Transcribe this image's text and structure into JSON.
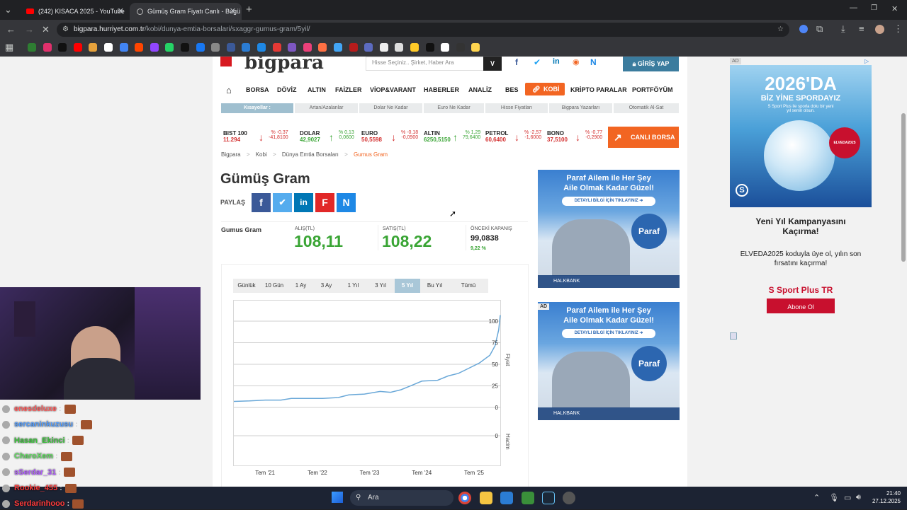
{
  "browser": {
    "tabs": [
      {
        "title": "(242) KISACA 2025 - YouTube",
        "active": false
      },
      {
        "title": "Gümüş Gram Fiyatı Canlı - Bugü",
        "active": true
      }
    ],
    "new_tab": "+",
    "url_host": "bigpara.hurriyet.com.tr",
    "url_path": "/kobi/dunya-emtia-borsalari/sxaggr-gumus-gram/5yil/",
    "window_controls": {
      "minimize": "—",
      "maximize": "❐",
      "close": "✕"
    }
  },
  "site": {
    "logo": "bigpara",
    "search_placeholder": "Hisse Seçiniz.. Şirket, Haber Ara",
    "login_label": "GİRİŞ YAP",
    "nav": [
      "BORSA",
      "DÖVİZ",
      "ALTIN",
      "FAİZLER",
      "VİOP&VARANT",
      "HABERLER",
      "ANALİZ",
      "BES",
      "KOBİ",
      "KRİPTO PARALAR",
      "PORTFÖYÜM"
    ],
    "quicklinks": [
      "Kısayollar :",
      "Artan/Azalanlar",
      "Dolar Ne Kadar",
      "Euro Ne Kadar",
      "Hisse Fiyatları",
      "Bigpara Yazarları",
      "Otomatik Al-Sat"
    ],
    "market": [
      {
        "name": "BIST 100",
        "value": "11.294",
        "pct": "% -0,37",
        "chg": "-41,8100",
        "dir": "down"
      },
      {
        "name": "DOLAR",
        "value": "42,9027",
        "pct": "% 0,13",
        "chg": "0,0600",
        "dir": "up"
      },
      {
        "name": "EURO",
        "value": "50,5598",
        "pct": "% -0,18",
        "chg": "-0,0900",
        "dir": "down"
      },
      {
        "name": "ALTIN",
        "value": "6250,5150",
        "pct": "% 1,29",
        "chg": "79,6400",
        "dir": "up"
      },
      {
        "name": "PETROL",
        "value": "60,6400",
        "pct": "% -2,57",
        "chg": "-1,6000",
        "dir": "down"
      },
      {
        "name": "BONO",
        "value": "37,5100",
        "pct": "% -0,77",
        "chg": "-0,2900",
        "dir": "down"
      }
    ],
    "live_button": "CANLI BORSA",
    "breadcrumb": [
      "Bigpara",
      "Kobi",
      "Dünya Emtia Borsaları",
      "Gumus Gram"
    ],
    "breadcrumb_sep": ">",
    "title": "Gümüş Gram",
    "share_label": "PAYLAŞ",
    "quote": {
      "name": "Gumus Gram",
      "bid_label": "ALIŞ(TL)",
      "bid": "108,11",
      "ask_label": "SATIŞ(TL)",
      "ask": "108,22",
      "prev_label": "ÖNCEKİ KAPANIŞ",
      "prev": "99,0838",
      "change": "9,22 %"
    },
    "periods": [
      "Günlük",
      "10 Gün",
      "1 Ay",
      "3 Ay",
      "1 Yıl",
      "3 Yıl",
      "5 Yıl",
      "Bu Yıl",
      "Tümü"
    ],
    "active_period": "5 Yıl"
  },
  "chart_data": {
    "type": "line",
    "ylabel": "Fiyat",
    "ylabel2": "Hacim",
    "yticks": [
      0,
      25,
      50,
      75,
      100
    ],
    "ylim": [
      0,
      100
    ],
    "volume_ticks": [
      0
    ],
    "xticks": [
      "Tem '21",
      "Tem '22",
      "Tem '23",
      "Tem '24",
      "Tem '25"
    ],
    "series": [
      {
        "x": [
          2020.9,
          2021.2,
          2021.5,
          2021.8,
          2022.0,
          2022.3,
          2022.6,
          2022.9,
          2023.1,
          2023.4,
          2023.7,
          2023.9,
          2024.1,
          2024.3,
          2024.5,
          2024.8,
          2025.0,
          2025.2,
          2025.4,
          2025.6,
          2025.8,
          2025.9,
          2025.97,
          2026.0
        ],
        "y": [
          7,
          8,
          8,
          9,
          10,
          11,
          10,
          12,
          14,
          16,
          18,
          18,
          20,
          26,
          30,
          32,
          36,
          40,
          45,
          52,
          60,
          72,
          90,
          107
        ]
      }
    ],
    "grid": true
  },
  "ads": {
    "paraf": {
      "headline1": "Paraf Ailem ile Her Şey",
      "headline2": "Aile Olmak Kadar Güzel!",
      "cta": "DETAYLI BİLGİ İÇİN TIKLAYINIZ ➜",
      "brand": "Paraf",
      "bank": "HALKBANK",
      "ad_tag": "AD"
    },
    "side": {
      "title1": "2026'DA",
      "title2": "BİZ YİNE SPORDAYIZ",
      "sub": "S Sport Plus ile sporla dolu bir yeni yıl senin olsun.",
      "badge": "ELVEDA2025",
      "heading": "Yeni Yıl Kampanyasını Kaçırma!",
      "body": "ELVEDA2025 koduyla üye ol, yılın son fırsatını kaçırma!",
      "brand": "S Sport Plus TR",
      "cta": "Abone Ol"
    }
  },
  "stream": {
    "chat": [
      {
        "user": "enesdeluxe",
        "color": "#ff5c5c"
      },
      {
        "user": "sercaninkuzusu",
        "color": "#4f9cff"
      },
      {
        "user": "Hasan_Ekinci",
        "color": "#3cc33c"
      },
      {
        "user": "CharoXem",
        "color": "#5fe05f"
      },
      {
        "user": "sSerdar_31",
        "color": "#b05cff"
      },
      {
        "user": "Rookie_455",
        "color": "#ff3b3b"
      },
      {
        "user": "Serdarinhooo",
        "color": "#ff3b3b"
      }
    ],
    "sep": ":"
  },
  "taskbar": {
    "search": "Ara",
    "time": "21:40",
    "date": "27.12.2025"
  }
}
